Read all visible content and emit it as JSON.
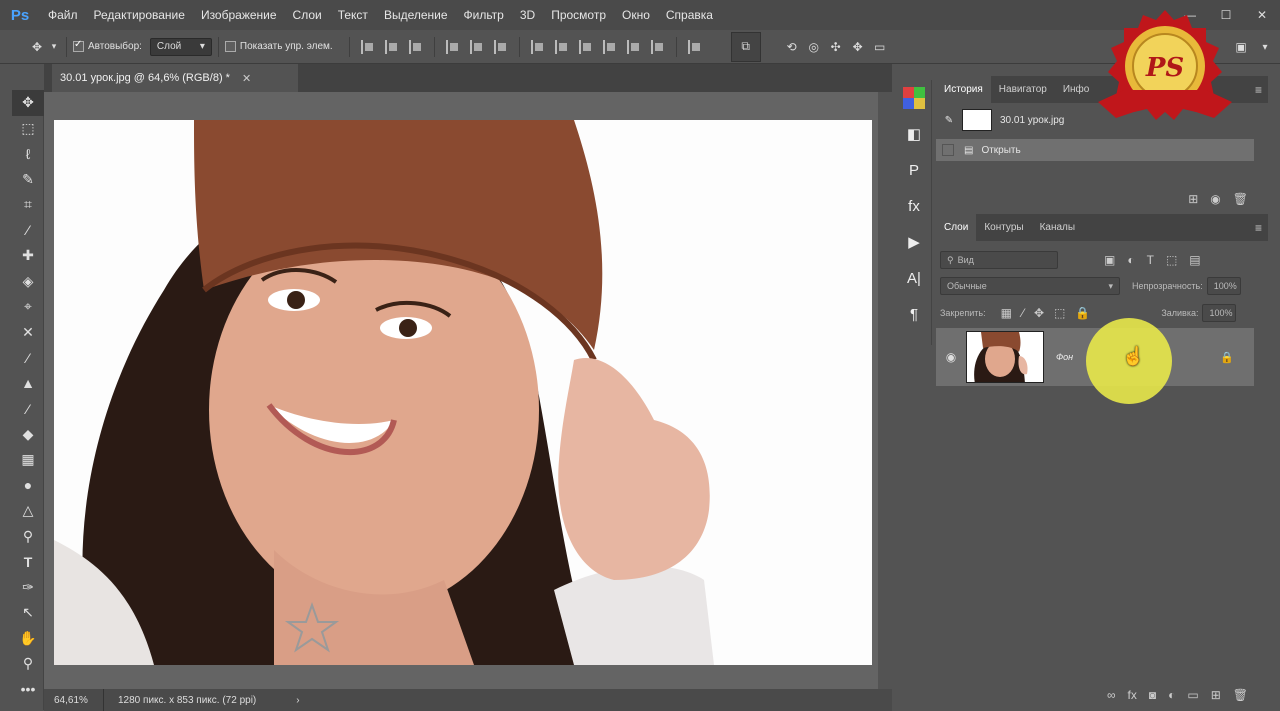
{
  "app": {
    "logo": "Ps"
  },
  "menu": [
    "Файл",
    "Редактирование",
    "Изображение",
    "Слои",
    "Текст",
    "Выделение",
    "Фильтр",
    "3D",
    "Просмотр",
    "Окно",
    "Справка"
  ],
  "window_controls": {
    "minimize": "—",
    "maximize": "☐",
    "close": "✕"
  },
  "options": {
    "autoselect_label": "Автовыбор:",
    "autoselect_value": "Слой",
    "show_controls_label": "Показать упр. элем."
  },
  "document": {
    "tab_title": "30.01 урок.jpg @ 64,6% (RGB/8) *",
    "tab_close": "✕",
    "zoom": "64,61%",
    "info": "1280 пикс. x 853 пикс. (72 ppi)",
    "info_arrow": "›"
  },
  "history_panel": {
    "tabs": [
      "История",
      "Навигатор",
      "Инфо"
    ],
    "snapshot_name": "30.01 урок.jpg",
    "steps": [
      "Открыть"
    ]
  },
  "layers_panel": {
    "tabs": [
      "Слои",
      "Контуры",
      "Каналы"
    ],
    "filter_placeholder": "Вид",
    "blend_mode": "Обычные",
    "opacity_label": "Непрозрачность:",
    "opacity_value": "100%",
    "lock_label": "Закрепить:",
    "fill_label": "Заливка:",
    "fill_value": "100%",
    "layers": [
      {
        "name": "Фон",
        "locked": true
      }
    ]
  },
  "badge": {
    "text": "PS"
  },
  "colors": {
    "accent_blue": "#4aa3ff",
    "cursor_highlight": "#e8e84a",
    "badge_red": "#c0161b",
    "badge_gold": "#e8b93a"
  }
}
